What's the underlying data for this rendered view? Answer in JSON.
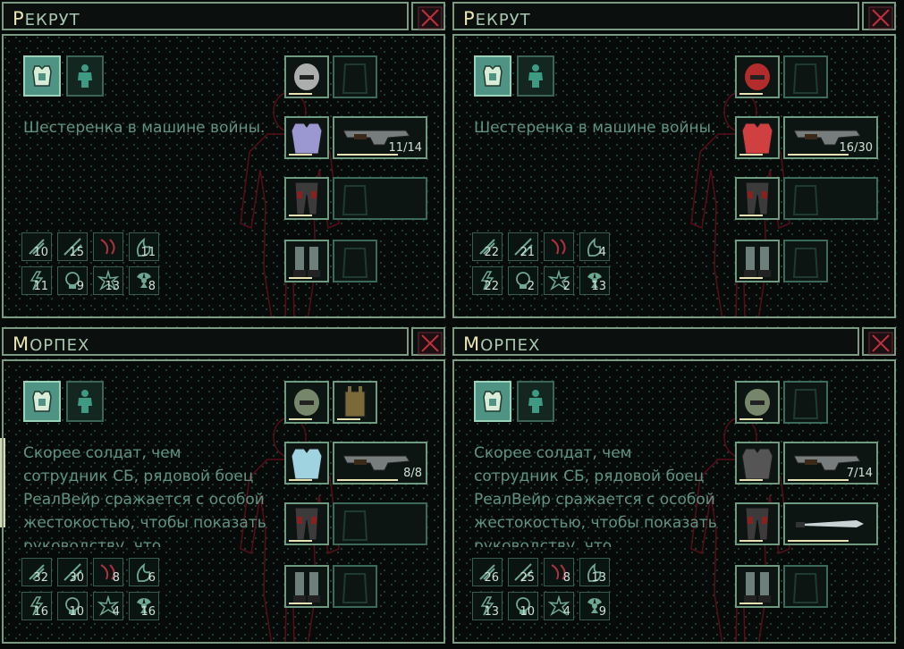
{
  "panels": [
    {
      "title": "Рекрут",
      "description": "Шестеренка в машине войны.",
      "stats": [
        "10",
        "15",
        "",
        "11",
        "11",
        "9",
        "13",
        "8"
      ],
      "weapon_ammo": "11/14",
      "head_color": "#c9c9c9",
      "body_color": "#9a97d1"
    },
    {
      "title": "Рекрут",
      "description": "Шестеренка в машине войны.",
      "stats": [
        "22",
        "21",
        "",
        "4",
        "22",
        "2",
        "2",
        "13"
      ],
      "weapon_ammo": "16/30",
      "head_color": "#d03030",
      "body_color": "#d04040"
    },
    {
      "title": "Морпех",
      "description": "Скорее солдат, чем сотрудник СБ, рядовой боец РеалВейр сражается с особой жестокостью, чтобы показать руководству, что",
      "stats": [
        "32",
        "30",
        "8",
        "6",
        "16",
        "10",
        "4",
        "16"
      ],
      "weapon_ammo": "8/8",
      "head_color": "#8a9a7a",
      "body_color": "#9fd3e0"
    },
    {
      "title": "Морпех",
      "description": "Скорее солдат, чем сотрудник СБ, рядовой боец РеалВейр сражается с особой жестокостью, чтобы показать руководству, что",
      "stats": [
        "26",
        "25",
        "8",
        "13",
        "13",
        "10",
        "4",
        "9"
      ],
      "weapon_ammo": "7/14",
      "head_color": "#8a9a7a",
      "body_color": "#555555"
    }
  ],
  "icons": {
    "close": "close-x-icon",
    "mode_active": "armor-mode-icon",
    "mode_inactive": "person-mode-icon"
  },
  "colors": {
    "accent": "#e9e4b0",
    "border": "#7c9a83",
    "text": "#5f9382",
    "close_x": "#c0303a"
  }
}
